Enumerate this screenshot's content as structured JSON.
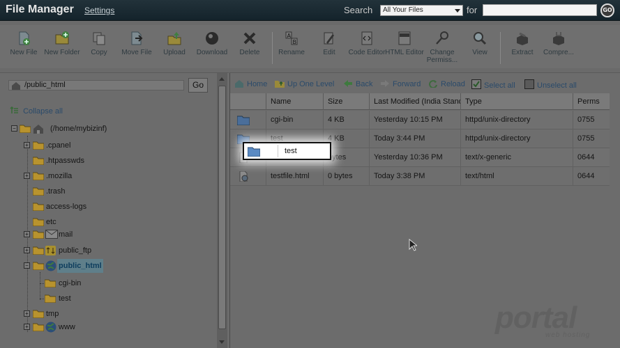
{
  "header": {
    "title": "File Manager",
    "settings_link": "Settings",
    "search_label": "Search",
    "search_scope": "All Your Files",
    "for_label": "for",
    "search_query": "",
    "go_label": "GO"
  },
  "toolbar": {
    "items": [
      {
        "label": "New File",
        "icon": "new-file-icon"
      },
      {
        "label": "New Folder",
        "icon": "new-folder-icon"
      },
      {
        "label": "Copy",
        "icon": "copy-icon"
      },
      {
        "label": "Move File",
        "icon": "move-file-icon"
      },
      {
        "label": "Upload",
        "icon": "upload-icon"
      },
      {
        "label": "Download",
        "icon": "download-icon"
      },
      {
        "label": "Delete",
        "icon": "delete-icon"
      },
      {
        "label": "Rename",
        "icon": "rename-icon"
      },
      {
        "label": "Edit",
        "icon": "edit-icon"
      },
      {
        "label": "Code Editor",
        "icon": "code-editor-icon"
      },
      {
        "label": "HTML Editor",
        "icon": "html-editor-icon"
      },
      {
        "label": "Change Permiss...",
        "icon": "change-permissions-icon"
      },
      {
        "label": "View",
        "icon": "view-icon"
      },
      {
        "label": "Extract",
        "icon": "extract-icon"
      },
      {
        "label": "Compre...",
        "icon": "compress-icon"
      }
    ]
  },
  "left": {
    "path_value": "/public_html",
    "go_label": "Go",
    "collapse_all": "Collapse all",
    "tree": [
      {
        "label": "(/home/mybizinf)",
        "icon": "home-icon"
      },
      {
        "label": ".cpanel"
      },
      {
        "label": ".htpasswds"
      },
      {
        "label": ".mozilla"
      },
      {
        "label": ".trash"
      },
      {
        "label": "access-logs"
      },
      {
        "label": "etc"
      },
      {
        "label": "mail",
        "icon": "mail-icon"
      },
      {
        "label": "public_ftp",
        "icon": "ftp-icon"
      },
      {
        "label": "public_html",
        "icon": "globe-icon"
      },
      {
        "label": "cgi-bin"
      },
      {
        "label": "test"
      },
      {
        "label": "tmp"
      },
      {
        "label": "www",
        "icon": "globe-icon"
      }
    ]
  },
  "right": {
    "nav": {
      "home": "Home",
      "up_one_level": "Up One Level",
      "back": "Back",
      "forward": "Forward",
      "reload": "Reload",
      "select_all": "Select all",
      "unselect_all": "Unselect all"
    },
    "columns": [
      "Name",
      "Size",
      "Last Modified (India Standard Time)",
      "Type",
      "Perms"
    ],
    "rows": [
      {
        "name": "cgi-bin",
        "size": "4 KB",
        "modified": "Yesterday 10:15 PM",
        "type": "httpd/unix-directory",
        "perms": "0755",
        "icon": "folder-icon"
      },
      {
        "name": "test",
        "size": "4 KB",
        "modified": "Today 3:44 PM",
        "type": "httpd/unix-directory",
        "perms": "0755",
        "icon": "folder-icon"
      },
      {
        "name": "",
        "size": "bytes",
        "modified": "Yesterday 10:36 PM",
        "type": "text/x-generic",
        "perms": "0644",
        "icon": "file-icon"
      },
      {
        "name": "testfile.html",
        "size": "0 bytes",
        "modified": "Today 3:38 PM",
        "type": "text/html",
        "perms": "0644",
        "icon": "html-file-icon"
      }
    ],
    "drag_ghost_label": "test"
  },
  "watermark": {
    "brand": "portal",
    "tagline": "web hosting"
  },
  "colors": {
    "header_bg": "#14232b",
    "link": "#2a4a6a",
    "folder": "#b8932e"
  }
}
